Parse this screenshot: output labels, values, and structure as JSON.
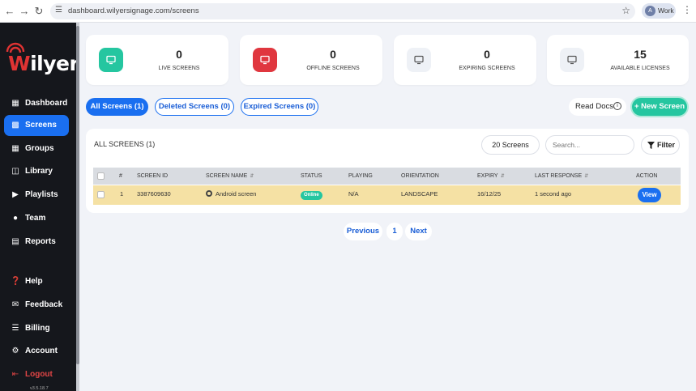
{
  "browser": {
    "url": "dashboard.wilyersignage.com/screens",
    "profile_initial": "A",
    "profile_label": "Work"
  },
  "brand": {
    "logo_text": "Wilyer",
    "logo_color": "#e03333"
  },
  "sidebar": {
    "items": [
      {
        "label": "Dashboard",
        "icon": "dashboard-icon"
      },
      {
        "label": "Screens",
        "icon": "monitor-icon",
        "active": true
      },
      {
        "label": "Groups",
        "icon": "grid-icon"
      },
      {
        "label": "Library",
        "icon": "library-icon"
      },
      {
        "label": "Playlists",
        "icon": "playlist-icon"
      },
      {
        "label": "Team",
        "icon": "team-icon"
      },
      {
        "label": "Reports",
        "icon": "report-icon"
      },
      {
        "label": "Help",
        "icon": "help-icon"
      },
      {
        "label": "Feedback",
        "icon": "feedback-icon"
      },
      {
        "label": "Billing",
        "icon": "cart-icon"
      },
      {
        "label": "Account",
        "icon": "gear-icon"
      },
      {
        "label": "Logout",
        "icon": "logout-icon"
      }
    ],
    "version": "v3.5.18.7"
  },
  "stats": [
    {
      "value": "0",
      "label": "LIVE SCREENS",
      "color": "#25c6a0"
    },
    {
      "value": "0",
      "label": "OFFLINE SCREENS",
      "color": "#e0373f"
    },
    {
      "value": "0",
      "label": "EXPIRING SCREENS",
      "color": "#eef1f6"
    },
    {
      "value": "15",
      "label": "AVAILABLE LICENSES",
      "color": "#eef1f6"
    }
  ],
  "tabs": {
    "all": "All Screens (1)",
    "deleted": "Deleted Screens (0)",
    "expired": "Expired Screens (0)"
  },
  "actions": {
    "read_docs": "Read Docs",
    "new_screen": "+ New Screen"
  },
  "table": {
    "title": "ALL SCREENS (1)",
    "count": "20 Screens",
    "search_placeholder": "Search...",
    "filter_label": "Filter",
    "headers": {
      "num": "#",
      "screen_id": "SCREEN ID",
      "screen_name": "SCREEN NAME",
      "status": "STATUS",
      "playing": "PLAYING",
      "orientation": "ORIENTATION",
      "expiry": "EXPIRY",
      "last_response": "LAST RESPONSE",
      "action": "ACTION"
    },
    "rows": [
      {
        "num": "1",
        "screen_id": "3387609630",
        "screen_name": "Android screen",
        "status": "Online",
        "playing": "N/A",
        "orientation": "LANDSCAPE",
        "expiry": "16/12/25",
        "last_response": "1 second ago",
        "action": "View"
      }
    ]
  },
  "pagination": {
    "previous": "Previous",
    "page": "1",
    "next": "Next"
  }
}
